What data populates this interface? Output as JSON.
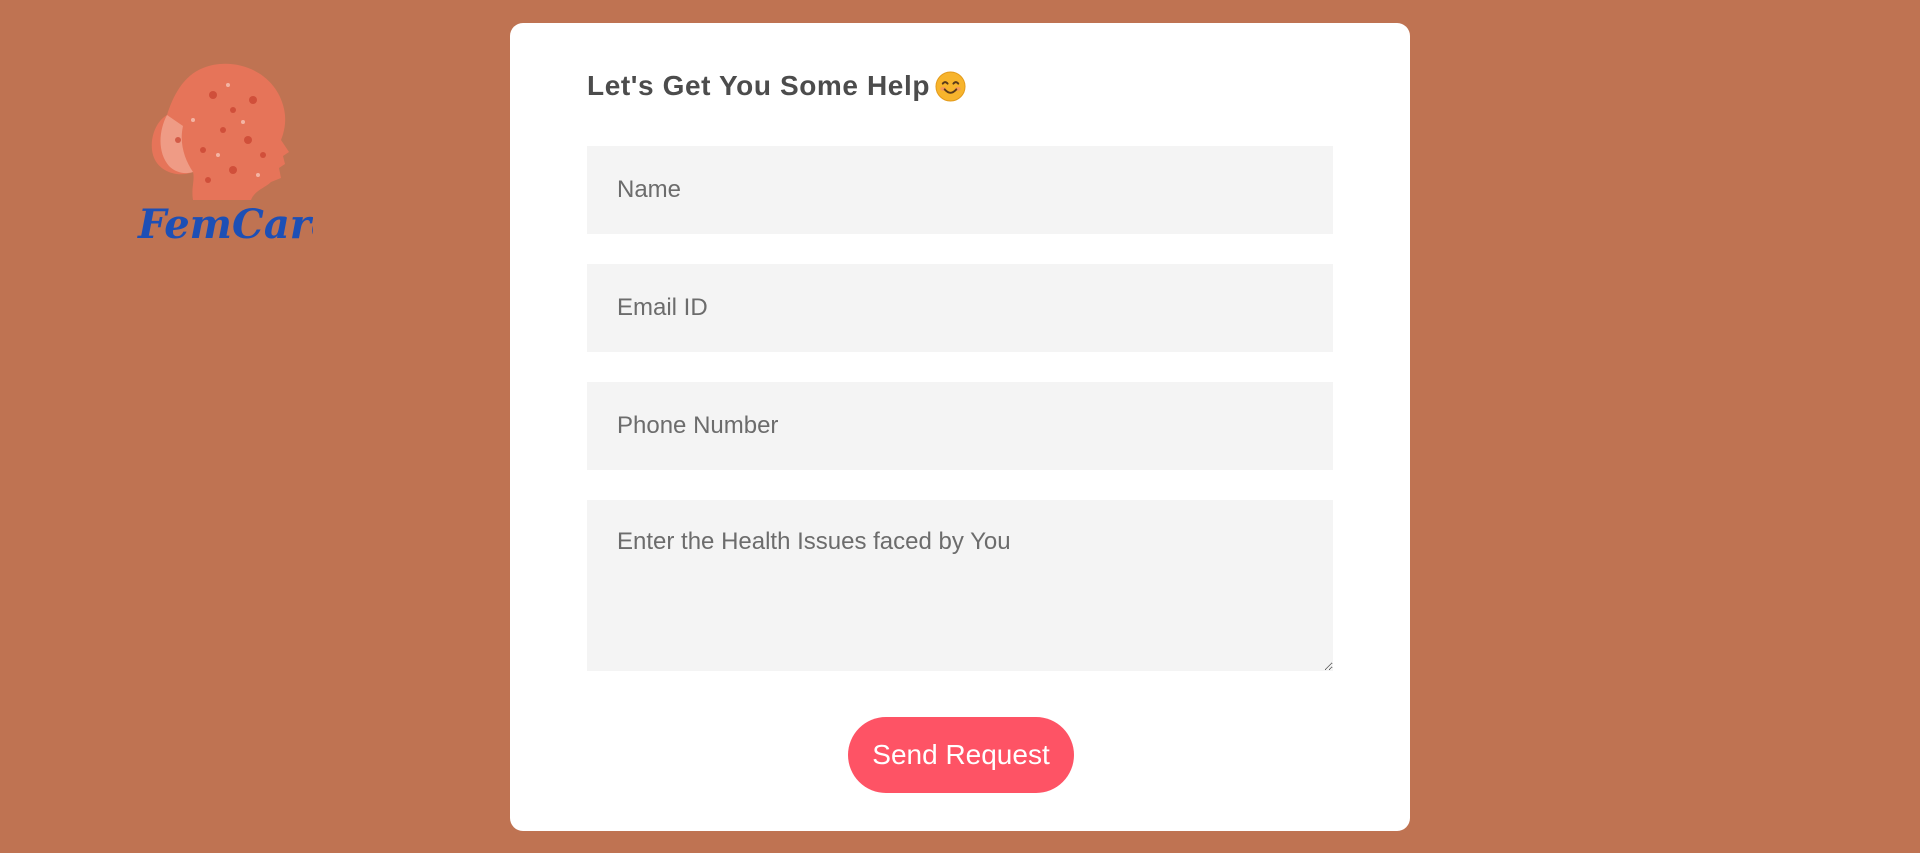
{
  "logo": {
    "text": "FemCare",
    "icon": "woman-head-profile-logo"
  },
  "form": {
    "title": "Let's Get You Some Help",
    "title_icon": "smiling-face-emoji",
    "name_placeholder": "Name",
    "email_placeholder": "Email ID",
    "phone_placeholder": "Phone Number",
    "issues_placeholder": "Enter the Health Issues faced by You",
    "submit_label": "Send Request"
  },
  "colors": {
    "background": "#bf7352",
    "card": "#ffffff",
    "field_bg": "#f4f4f4",
    "button": "#fe5365",
    "title_text": "#4c4c4c",
    "logo_text": "#1d4fb5"
  }
}
